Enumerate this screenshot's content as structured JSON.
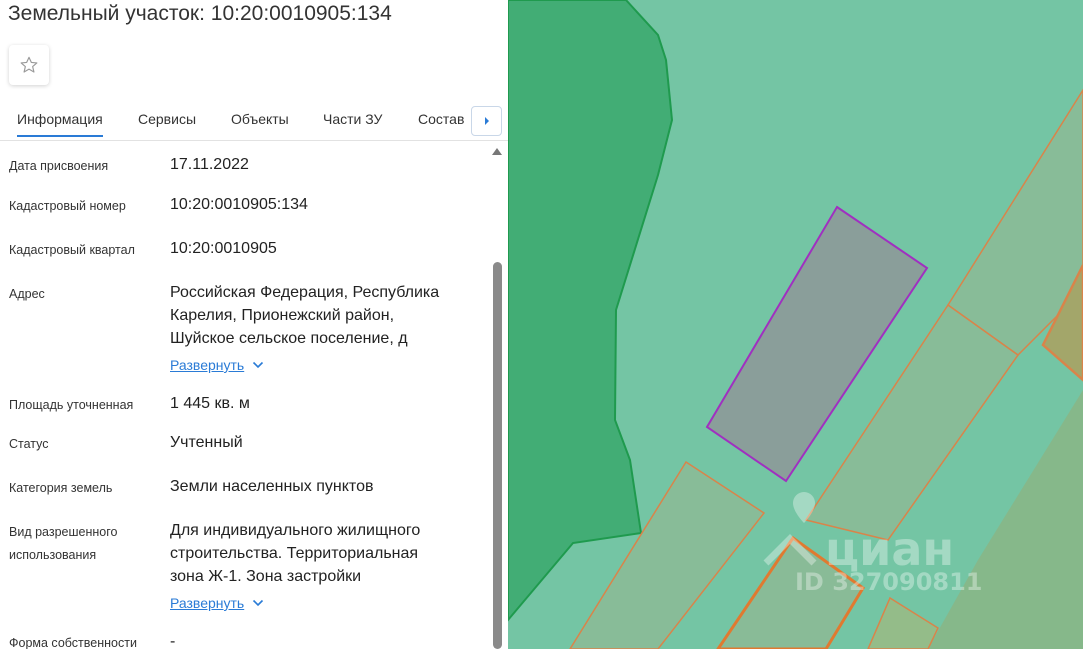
{
  "title": "Земельный участок: 10:20:0010905:134",
  "favorite": {
    "icon": "star-outline-icon"
  },
  "tabs": [
    {
      "label": "Информация",
      "active": true
    },
    {
      "label": "Сервисы"
    },
    {
      "label": "Объекты"
    },
    {
      "label": "Части ЗУ"
    },
    {
      "label": "Состав"
    }
  ],
  "tab_next_icon": "caret-right-icon",
  "fields": {
    "date": {
      "label": "Дата присвоения",
      "value": "17.11.2022"
    },
    "cadnum": {
      "label": "Кадастровый номер",
      "value": "10:20:0010905:134"
    },
    "quarter": {
      "label": "Кадастровый квартал",
      "value": "10:20:0010905"
    },
    "address": {
      "label": "Адрес",
      "value_lines": [
        "Российская Федерация, Республика",
        "Карелия, Прионежский район,",
        "Шуйское сельское поселение, д"
      ],
      "expand": "Развернуть"
    },
    "area": {
      "label": "Площадь уточненная",
      "value": "1 445 кв. м"
    },
    "status": {
      "label": "Статус",
      "value": "Учтенный"
    },
    "category": {
      "label": "Категория земель",
      "value": "Земли населенных пунктов"
    },
    "usage": {
      "label_lines": [
        "Вид разрешенного",
        "использования"
      ],
      "value_lines": [
        "Для индивидуального жилищного",
        "строительства. Территориальная",
        "зона Ж-1. Зона застройки"
      ],
      "expand": "Развернуть"
    },
    "ownership": {
      "label": "Форма собственности",
      "value": "-"
    }
  },
  "map": {
    "watermark_brand": "циан",
    "watermark_id": "ID 327090811",
    "colors": {
      "zone": "#74c5a4",
      "forest": "#42ad75",
      "selected_fill": "#8a9e9a",
      "selected_stroke": "#a030c0",
      "parcel_fill": "#8fb894",
      "parcel_stroke": "#d9844a"
    }
  }
}
